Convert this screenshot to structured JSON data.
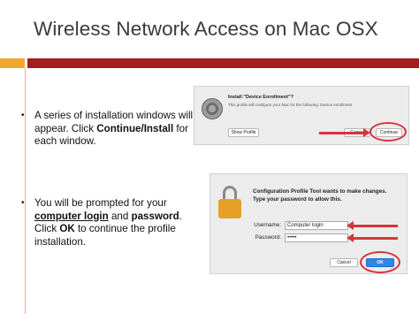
{
  "slide": {
    "title": "Wireless Network Access on Mac OSX",
    "accent_colors": {
      "orange": "#f0a830",
      "red": "#a31c1f",
      "annotation": "#d3363a"
    }
  },
  "bullets": [
    {
      "marker": "•",
      "parts": [
        "A series of installation windows will appear. Click ",
        "Continue/Install",
        " for each window."
      ]
    },
    {
      "marker": "•",
      "parts": [
        "You will be prompted for your ",
        "computer login",
        " and ",
        "password",
        ". Click ",
        "OK",
        " to continue the profile installation."
      ]
    }
  ],
  "dialog1": {
    "icon": "gear-icon",
    "title": "Install \"Device Enrollment\"?",
    "subtitle": "This profile will configure your Mac for the following: Device enrollment",
    "show_profile_label": "Show Profile",
    "cancel_label": "Cancel",
    "continue_label": "Continue"
  },
  "dialog2": {
    "icon": "lock-icon",
    "title": "Configuration Profile Tool wants to make changes.",
    "subtitle": "Type your password to allow this.",
    "username_label": "Username:",
    "username_value": "Computer login",
    "password_label": "Password:",
    "password_value": "•••••",
    "cancel_label": "Cancel",
    "ok_label": "OK"
  }
}
